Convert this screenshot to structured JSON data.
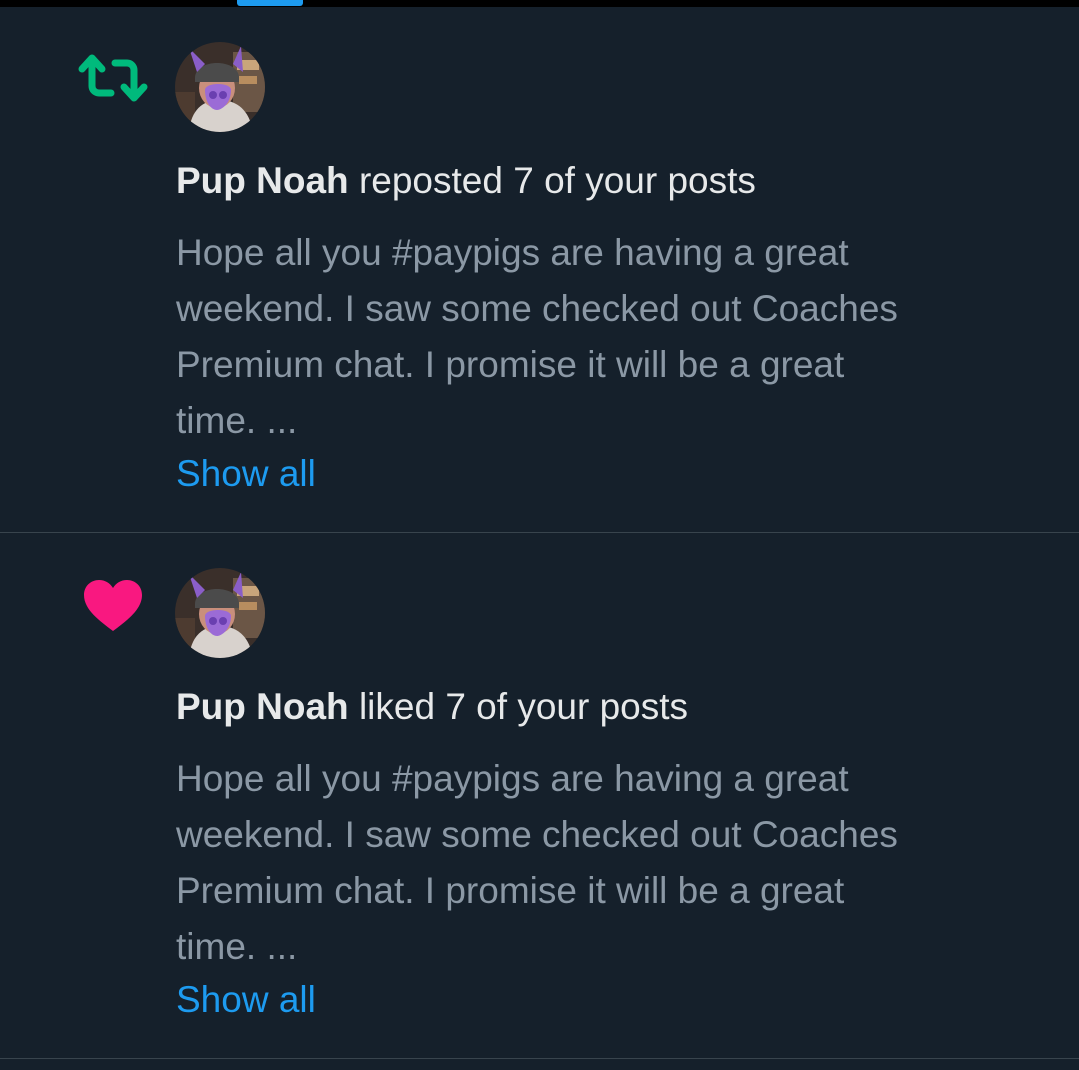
{
  "notifications": [
    {
      "type": "repost",
      "icon": "repost-icon",
      "icon_color": "#00ba7c",
      "actor": "Pup Noah",
      "action": "reposted 7 of your posts",
      "excerpt_lines": [
        "Hope all you #paypigs are having a great",
        "weekend. I saw some checked out Coaches",
        "Premium chat. I promise it will be a great",
        "time. ..."
      ],
      "show_all": "Show all"
    },
    {
      "type": "like",
      "icon": "heart-icon",
      "icon_color": "#f91880",
      "actor": "Pup Noah",
      "action": "liked 7 of your posts",
      "excerpt_lines": [
        "Hope all you #paypigs are having a great",
        "weekend. I saw some checked out Coaches",
        "Premium chat. I promise it will be a great",
        "time. ..."
      ],
      "show_all": "Show all"
    }
  ],
  "colors": {
    "background": "#15202b",
    "primary_text": "#e7e9ea",
    "secondary_text": "#8b98a5",
    "link": "#1d9bf0",
    "divider": "#38444d"
  }
}
